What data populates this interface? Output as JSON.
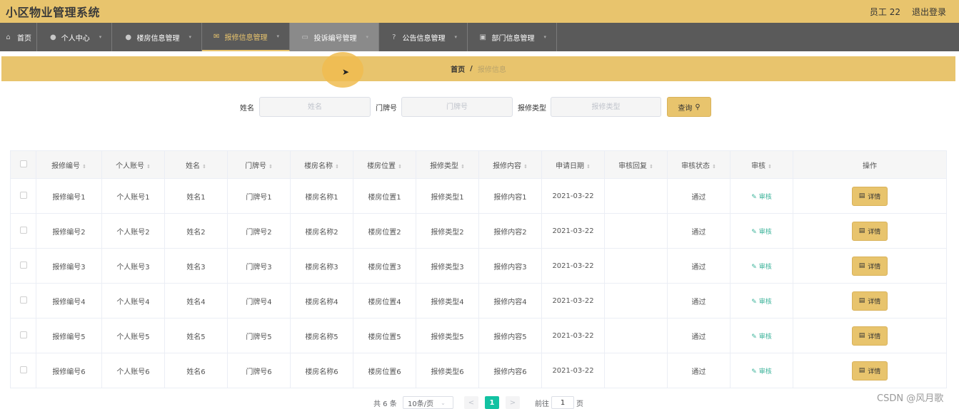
{
  "header": {
    "app_title": "小区物业管理系统",
    "user_label": "员工 22",
    "logout_label": "退出登录"
  },
  "nav": {
    "items": [
      {
        "label": "首页",
        "icon": "home-icon"
      },
      {
        "label": "个人中心",
        "icon": "user-icon"
      },
      {
        "label": "楼房信息管理",
        "icon": "location-icon"
      },
      {
        "label": "报修信息管理",
        "icon": "mail-icon",
        "state": "active"
      },
      {
        "label": "投诉编号管理",
        "icon": "document-icon",
        "state": "hover"
      },
      {
        "label": "公告信息管理",
        "icon": "help-icon"
      },
      {
        "label": "部门信息管理",
        "icon": "clipboard-icon"
      }
    ]
  },
  "breadcrumb": {
    "home": "首页",
    "separator": "/",
    "current": "报修信息"
  },
  "search": {
    "name_label": "姓名",
    "name_placeholder": "姓名",
    "door_label": "门牌号",
    "door_placeholder": "门牌号",
    "type_label": "报修类型",
    "type_placeholder": "报修类型",
    "button_label": "查询"
  },
  "table": {
    "columns": [
      "报修编号",
      "个人账号",
      "姓名",
      "门牌号",
      "楼房名称",
      "楼房位置",
      "报修类型",
      "报修内容",
      "申请日期",
      "审核回复",
      "审核状态",
      "审核",
      "操作"
    ],
    "audit_label": "审核",
    "detail_label": "详情",
    "rows": [
      {
        "repair_no": "报修编号1",
        "account": "个人账号1",
        "name": "姓名1",
        "door": "门牌号1",
        "building": "楼房名称1",
        "location": "楼房位置1",
        "repair_type": "报修类型1",
        "content": "报修内容1",
        "date": "2021-03-22",
        "reply": "",
        "status": "通过"
      },
      {
        "repair_no": "报修编号2",
        "account": "个人账号2",
        "name": "姓名2",
        "door": "门牌号2",
        "building": "楼房名称2",
        "location": "楼房位置2",
        "repair_type": "报修类型2",
        "content": "报修内容2",
        "date": "2021-03-22",
        "reply": "",
        "status": "通过"
      },
      {
        "repair_no": "报修编号3",
        "account": "个人账号3",
        "name": "姓名3",
        "door": "门牌号3",
        "building": "楼房名称3",
        "location": "楼房位置3",
        "repair_type": "报修类型3",
        "content": "报修内容3",
        "date": "2021-03-22",
        "reply": "",
        "status": "通过"
      },
      {
        "repair_no": "报修编号4",
        "account": "个人账号4",
        "name": "姓名4",
        "door": "门牌号4",
        "building": "楼房名称4",
        "location": "楼房位置4",
        "repair_type": "报修类型4",
        "content": "报修内容4",
        "date": "2021-03-22",
        "reply": "",
        "status": "通过"
      },
      {
        "repair_no": "报修编号5",
        "account": "个人账号5",
        "name": "姓名5",
        "door": "门牌号5",
        "building": "楼房名称5",
        "location": "楼房位置5",
        "repair_type": "报修类型5",
        "content": "报修内容5",
        "date": "2021-03-22",
        "reply": "",
        "status": "通过"
      },
      {
        "repair_no": "报修编号6",
        "account": "个人账号6",
        "name": "姓名6",
        "door": "门牌号6",
        "building": "楼房名称6",
        "location": "楼房位置6",
        "repair_type": "报修类型6",
        "content": "报修内容6",
        "date": "2021-03-22",
        "reply": "",
        "status": "通过"
      }
    ]
  },
  "pagination": {
    "total_text": "共 6 条",
    "page_size": "10条/页",
    "prev": "<",
    "current_page": "1",
    "next": ">",
    "goto_label": "前往",
    "goto_value": "1",
    "page_unit": "页"
  },
  "watermark": "CSDN @风月歌",
  "colors": {
    "accent": "#e8c46d",
    "nav_bg": "#5a5a5a",
    "audit_link": "#3cb39a",
    "current_page": "#13c2a2"
  }
}
